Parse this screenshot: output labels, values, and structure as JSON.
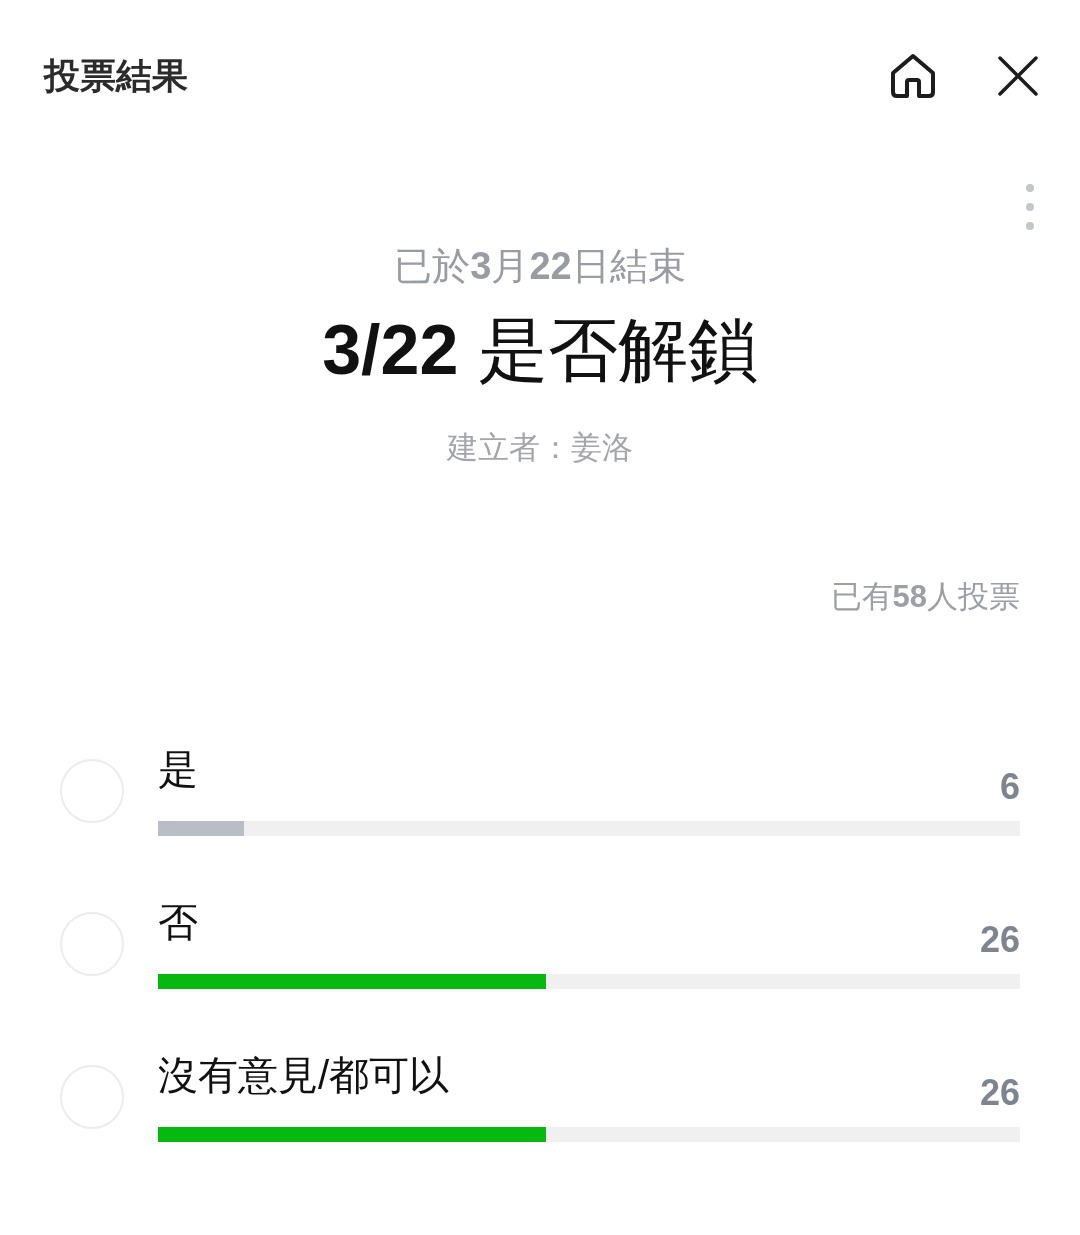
{
  "header": {
    "title": "投票結果"
  },
  "poll": {
    "status": "已於**3**月**22**日結束",
    "title": "**3/22** 是否解鎖",
    "creator": "建立者：姜洛",
    "voter_count": "已有**58**人投票"
  },
  "options": [
    {
      "label": "是",
      "count": "6",
      "level": 0.1,
      "color": "#b9bdc6",
      "selected": false
    },
    {
      "label": "否",
      "count": "26",
      "level": 0.45,
      "color": "#06b80f",
      "selected": false
    },
    {
      "label": "沒有意見/都可以",
      "count": "26",
      "level": 0.45,
      "color": "#06b80f",
      "selected": false
    }
  ]
}
